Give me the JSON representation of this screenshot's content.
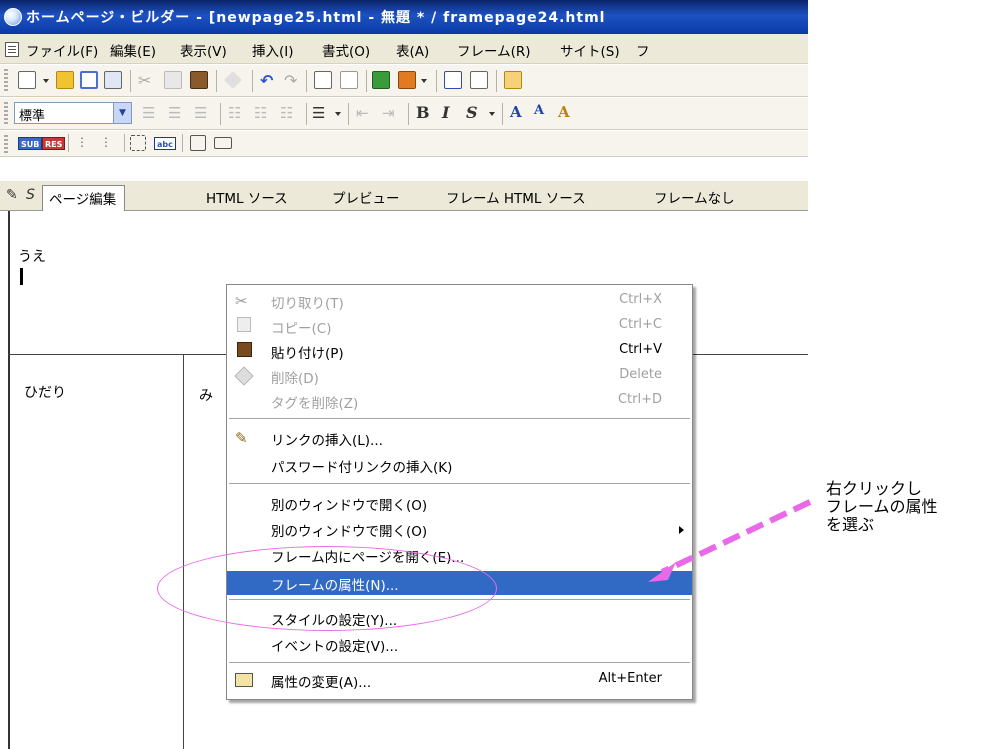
{
  "window": {
    "title": "ホームページ・ビルダー - [newpage25.html - 無題 * / framepage24.html"
  },
  "menubar": {
    "items": [
      "ファイル(F)",
      "編集(E)",
      "表示(V)",
      "挿入(I)",
      "書式(O)",
      "表(A)",
      "フレーム(R)",
      "サイト(S)",
      "フ"
    ]
  },
  "format_toolbar": {
    "style_value": "標準"
  },
  "tabs": {
    "page_edit": "ページ編集",
    "html_source": "HTML ソース",
    "preview": "プレビュー",
    "frame_html_source": "フレーム HTML ソース",
    "no_frame": "フレームなし"
  },
  "frames": {
    "top_text": "うえ",
    "left_text": "ひだり",
    "right_text": "み"
  },
  "context_menu": {
    "items": [
      {
        "label": "切り取り(T)",
        "shortcut": "Ctrl+X",
        "icon": "scissors-icon"
      },
      {
        "label": "コピー(C)",
        "shortcut": "Ctrl+C",
        "icon": "copy-icon"
      },
      {
        "label": "貼り付け(P)",
        "shortcut": "Ctrl+V",
        "icon": "paste-icon"
      },
      {
        "label": "削除(D)",
        "shortcut": "Delete",
        "icon": "eraser-icon"
      },
      {
        "label": "タグを削除(Z)",
        "shortcut": "Ctrl+D"
      },
      {
        "label": "リンクの挿入(L)...",
        "icon": "link-icon"
      },
      {
        "label": "パスワード付リンクの挿入(K)"
      },
      {
        "label": "別のウィンドウで開く(O)"
      },
      {
        "label": "別のウィンドウで開く(O)"
      },
      {
        "label": "フレーム内にページを開く(E)..."
      },
      {
        "label": "フレームの属性(N)..."
      },
      {
        "label": "スタイルの設定(Y)..."
      },
      {
        "label": "イベントの設定(V)..."
      },
      {
        "label": "属性の変更(A)...",
        "shortcut": "Alt+Enter",
        "icon": "attribute-icon"
      }
    ]
  },
  "annotation": {
    "line1": "右クリックし",
    "line2": "フレームの属性",
    "line3": "を選ぶ"
  },
  "colors": {
    "highlight": "#316ac5",
    "annotation_magenta": "#e86ae8"
  }
}
